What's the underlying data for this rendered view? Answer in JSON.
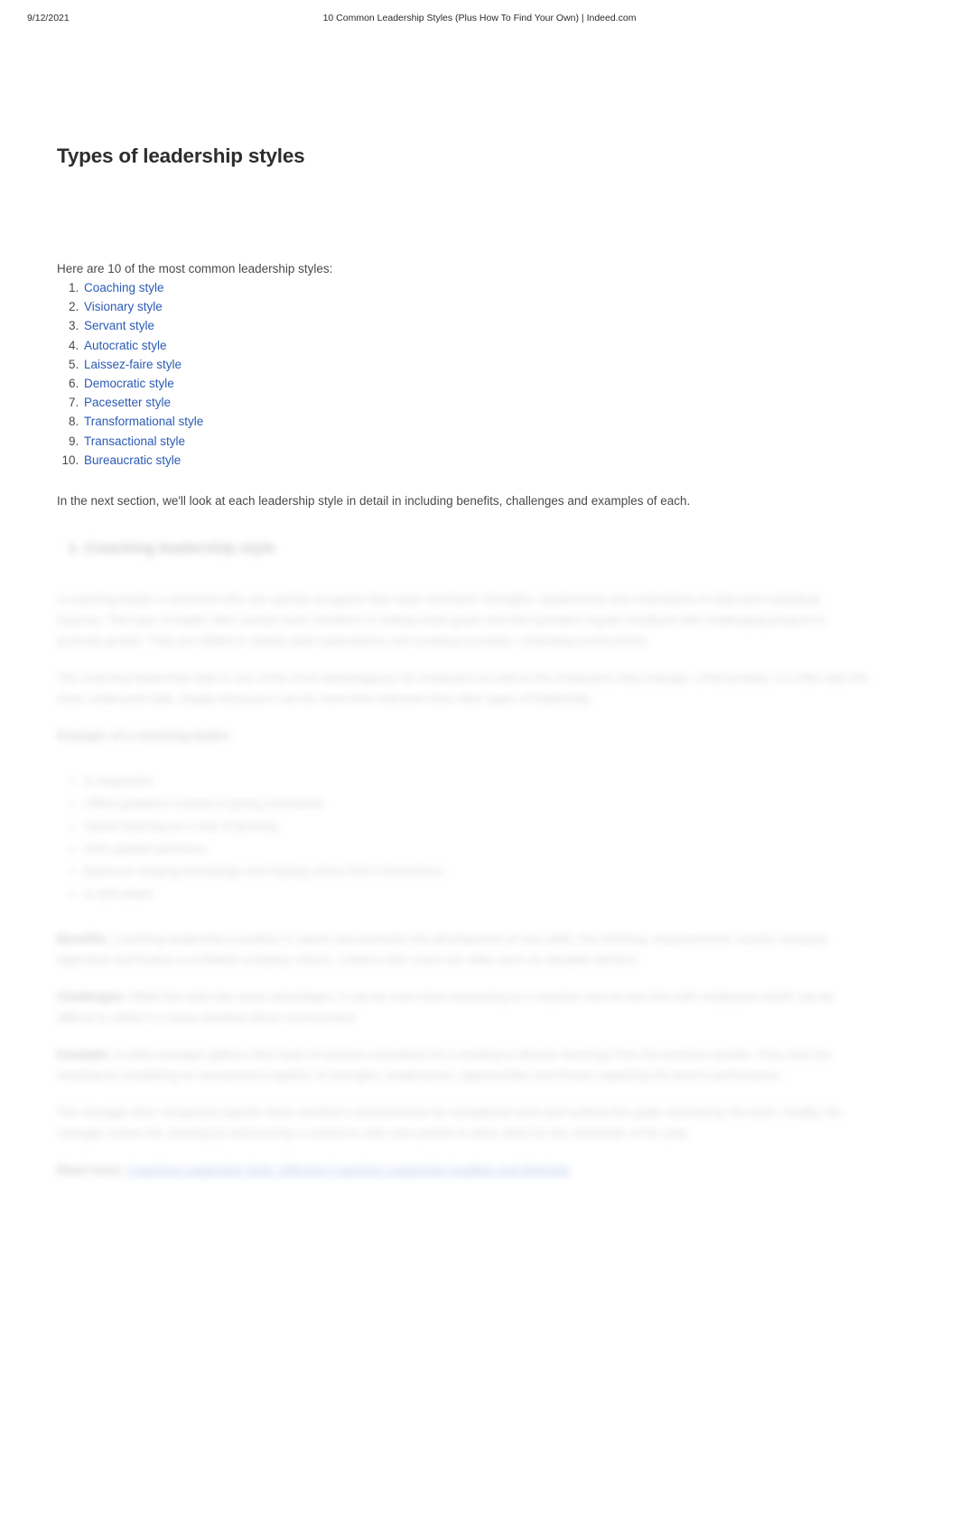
{
  "print_header": {
    "date": "9/12/2021",
    "title": "10 Common Leadership Styles (Plus How To Find Your Own) | Indeed.com"
  },
  "colors": {
    "link": "#2b5bb5",
    "heading": "#2d2d2d",
    "body_text": "#4a4a4a",
    "page_background": "#ffffff"
  },
  "article": {
    "heading": "Types of leadership styles",
    "intro": "Here are 10 of the most common leadership styles:",
    "styles_list": [
      "Coaching style",
      "Visionary style",
      "Servant style",
      "Autocratic style",
      "Laissez-faire style",
      "Democratic style",
      "Pacesetter style",
      "Transformational style",
      "Transactional style",
      "Bureaucratic style"
    ],
    "closing_paragraph": "In the next section, we'll look at each leadership style in detail in including benefits, challenges and examples of each."
  },
  "blurred_section": {
    "note": "Remainder of article is visually blurred / illegible",
    "heading": "1. Coaching leadership style",
    "paragraphs": [
      "A coaching leader is someone who can quickly recognize their team members' strengths, weaknesses and motivations to help each individual improve. This type of leader often assists team members in setting smart goals and then provides regular feedback with challenging projects to promote growth. They are skilled in setting clear expectations and creating a positive, motivating environment.",
      "The coaching leadership style is one of the most advantageous for employers as well as the employees they manage. Unfortunately, it is often also the more underused style, largely because it can be more time-intensive than other types of leadership.",
      "Example of a coaching leader:"
    ],
    "bullets": [
      "Is supportive",
      "Offers guidance instead of giving commands",
      "Values learning as a way of growing",
      "Asks guided questions",
      "Balances relaying knowledge and helping others find it themselves",
      "Is self-aware"
    ],
    "labeled_paragraphs": [
      {
        "label": "Benefits:",
        "text": "Coaching leadership is positive in nature and promotes the development of new skills, free-thinking, empowerment, revisits company objectives and fosters a confident company culture. Leaders who coach are often seen as valuable mentors."
      },
      {
        "label": "Challenges:",
        "text": "While this style has many advantages, it can be more time-consuming as it requires one-on-one time with employees which can be difficult to obtain in a busy deadline-driven environment."
      },
      {
        "label": "Example:",
        "text": "A sales manager gathers their team of account executives for a meeting to discuss learnings from the previous quarter. They start the meeting by completing an assessment together of strengths, weaknesses, opportunities and threats regarding the team's performance."
      },
      {
        "label": "",
        "text": "The manager then recognizes specific team member's achievements for exceptional work and outlines the goals reached by the team. Finally, the manager closes the meeting by announcing a contest to start next quarter to drive sales for the remainder of the year."
      },
      {
        "label": "Read more:",
        "text": "Coaching Leadership Style: Effective Coaching Leadership Qualities and Methods",
        "is_link": true
      }
    ]
  }
}
